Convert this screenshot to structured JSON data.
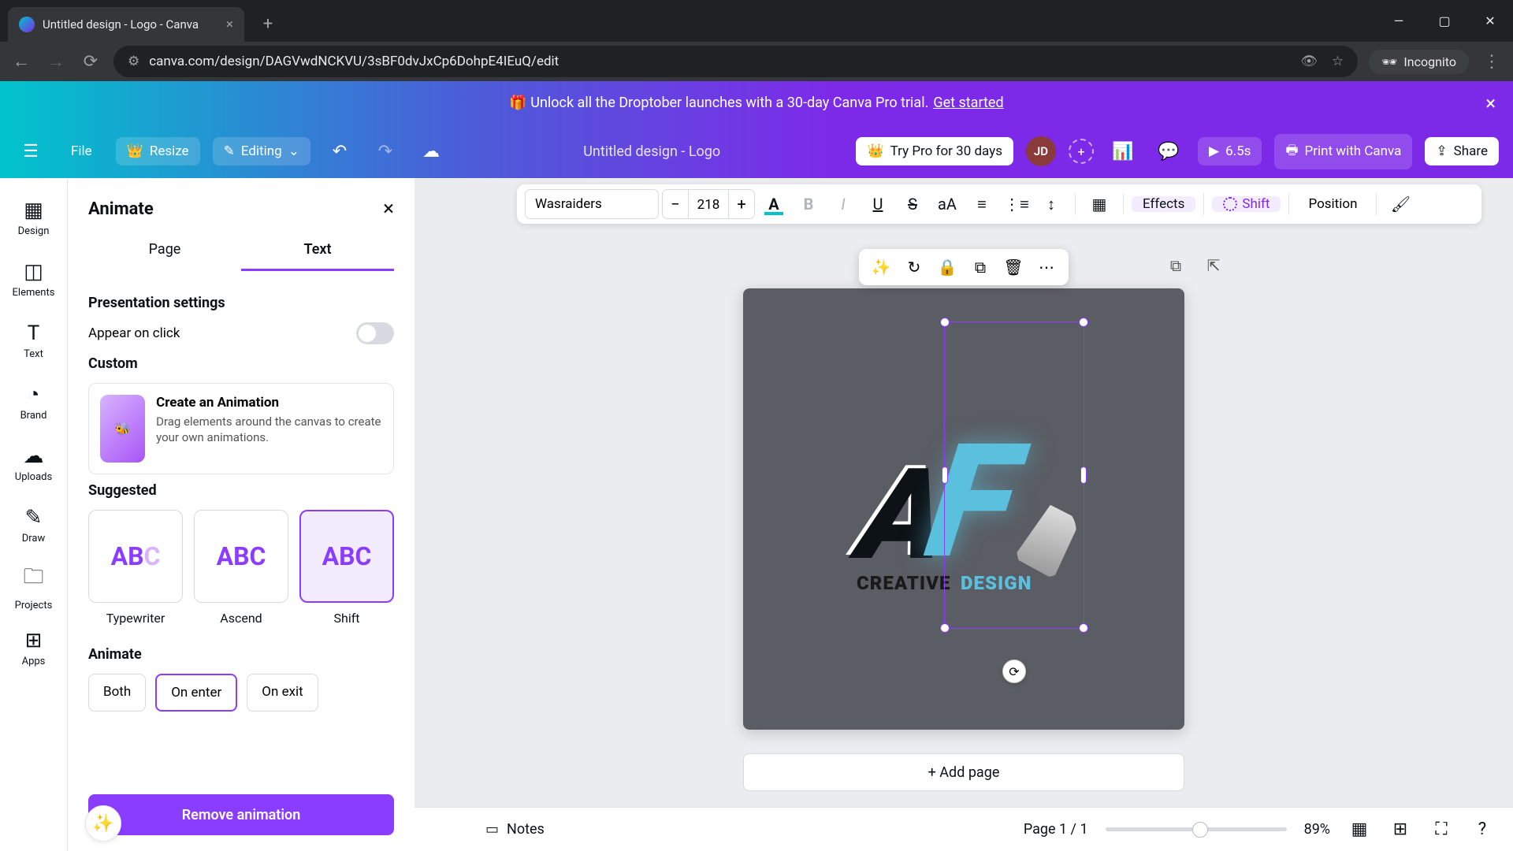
{
  "browser": {
    "tab_title": "Untitled design - Logo - Canva",
    "url": "canva.com/design/DAGVwdNCKVU/3sBF0dvJxCp6DohpE4IEuQ/edit",
    "incognito": "Incognito"
  },
  "promo": {
    "text": "🎁 Unlock all the Droptober launches with a 30-day Canva Pro trial.",
    "link": "Get started"
  },
  "appbar": {
    "file": "File",
    "resize": "Resize",
    "editing": "Editing",
    "doc_title": "Untitled design - Logo",
    "try_pro": "Try Pro for 30 days",
    "avatar": "JD",
    "duration": "6.5s",
    "print": "Print with Canva",
    "share": "Share"
  },
  "rail": {
    "design": "Design",
    "elements": "Elements",
    "text": "Text",
    "brand": "Brand",
    "uploads": "Uploads",
    "draw": "Draw",
    "projects": "Projects",
    "apps": "Apps"
  },
  "panel": {
    "title": "Animate",
    "tab_page": "Page",
    "tab_text": "Text",
    "presentation_h": "Presentation settings",
    "appear_click": "Appear on click",
    "custom_h": "Custom",
    "custom_title": "Create an Animation",
    "custom_desc": "Drag elements around the canvas to create your own animations.",
    "suggested_h": "Suggested",
    "anims": [
      {
        "label": "Typewriter",
        "sample": "AB"
      },
      {
        "label": "Ascend",
        "sample": "ABC"
      },
      {
        "label": "Shift",
        "sample": "ABC"
      }
    ],
    "animate_h": "Animate",
    "dir_both": "Both",
    "dir_enter": "On enter",
    "dir_exit": "On exit",
    "remove": "Remove animation"
  },
  "contextbar": {
    "font": "Wasraiders",
    "size": "218",
    "effects": "Effects",
    "anim_label": "Shift",
    "position": "Position"
  },
  "canvas": {
    "logo_word1": "Creative",
    "logo_word2": "Design",
    "add_page": "+ Add page"
  },
  "footer": {
    "notes": "Notes",
    "page_ind": "Page 1 / 1",
    "zoom": "89%"
  }
}
